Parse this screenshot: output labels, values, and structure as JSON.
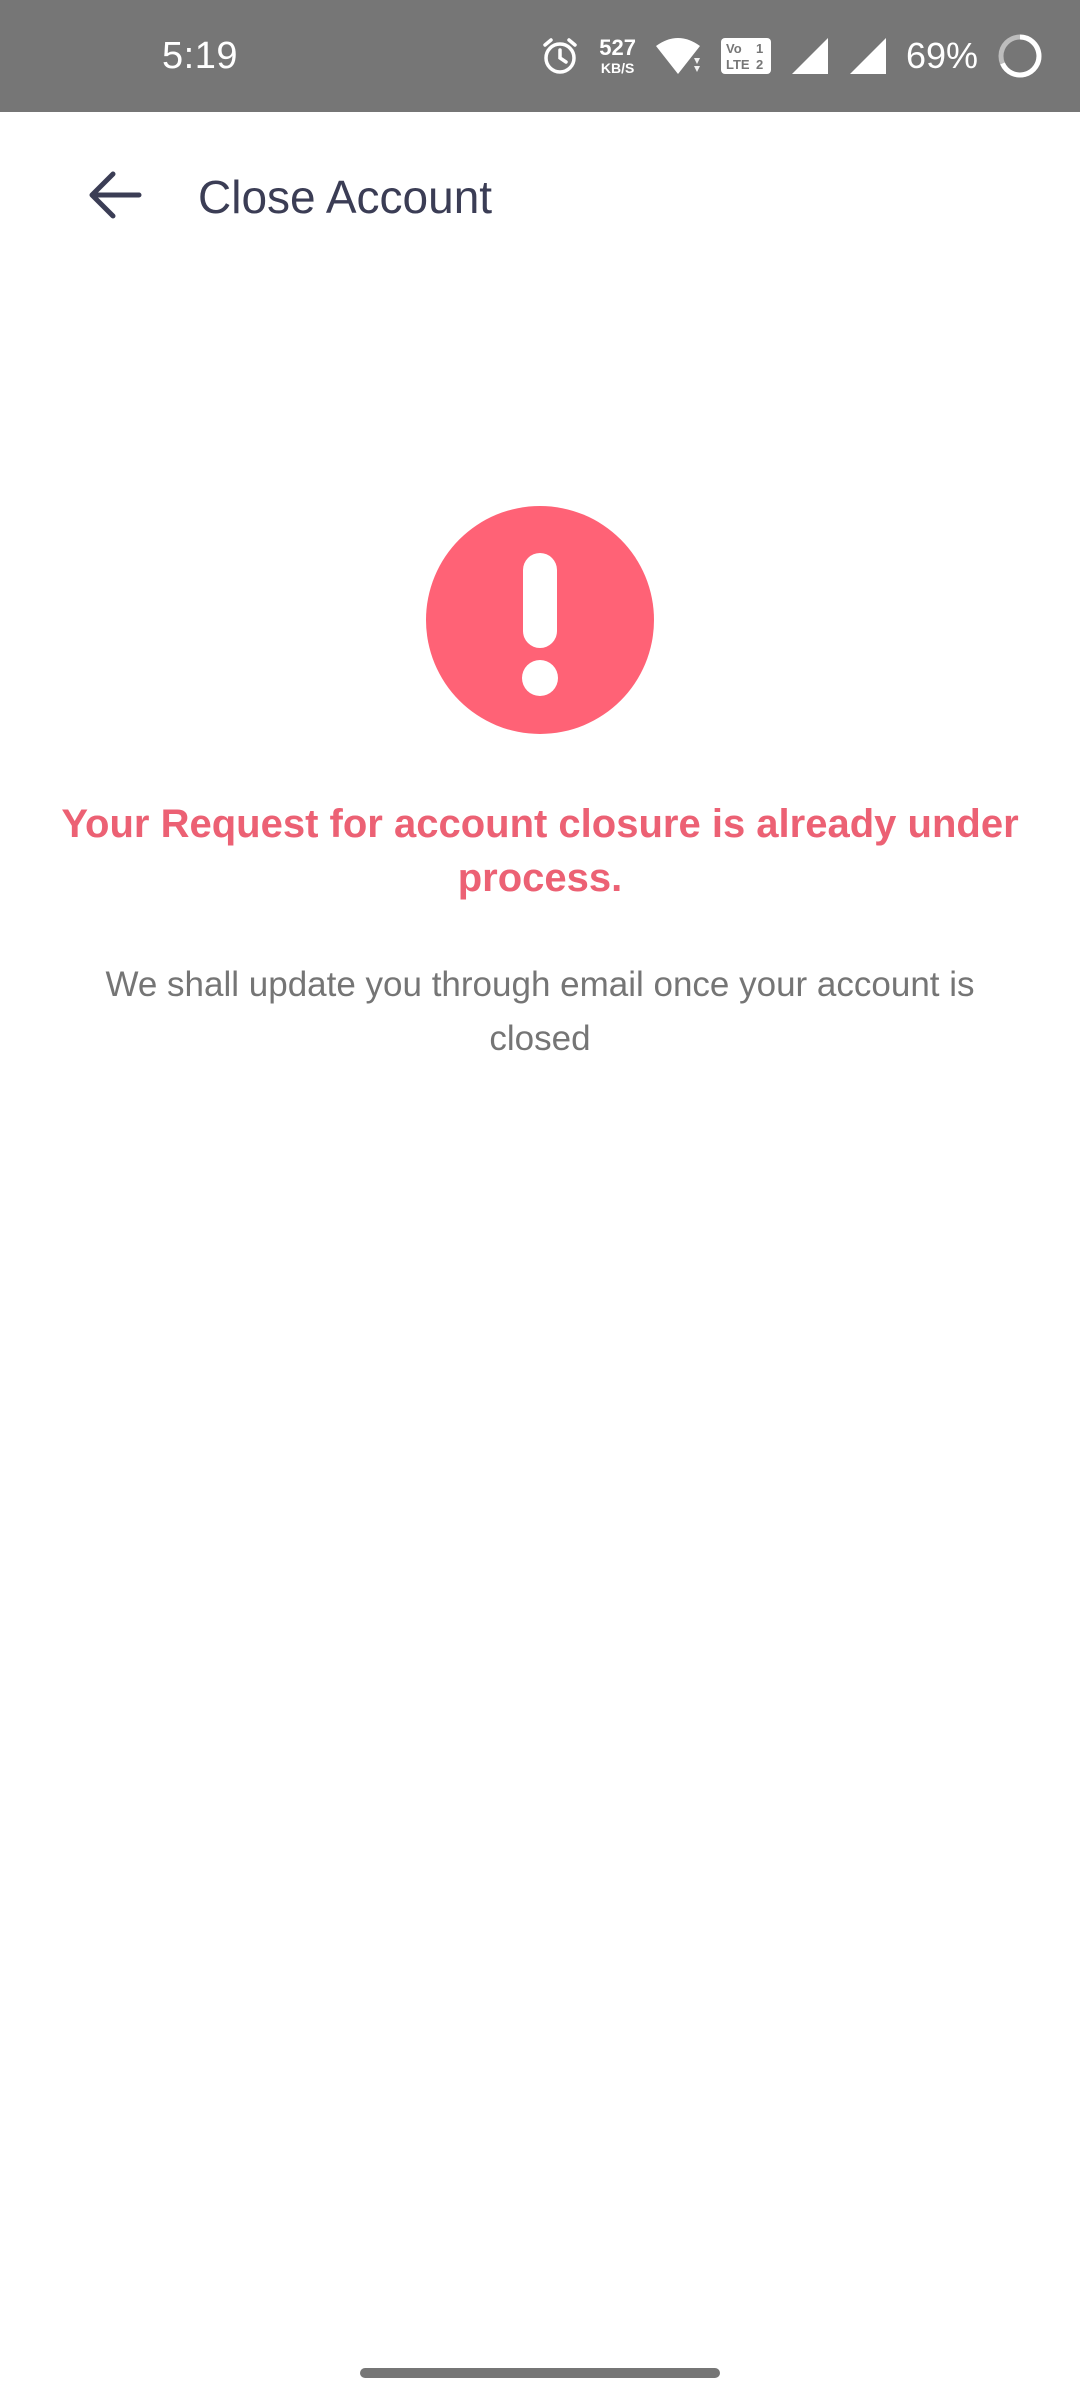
{
  "status_bar": {
    "time": "5:19",
    "speed_value": "527",
    "speed_unit": "KB/S",
    "battery": "69%",
    "icons": [
      "alarm-icon",
      "wifi-icon",
      "volte-icon",
      "signal-icon",
      "signal-icon",
      "battery-icon"
    ]
  },
  "header": {
    "back_icon": "arrow-left-icon",
    "title": "Close Account"
  },
  "main": {
    "alert_icon": "exclamation-circle-icon",
    "headline": "Your Request for account closure is already under process.",
    "message": "We shall update you through email once your account is closed"
  },
  "colors": {
    "status_bar_bg": "#767676",
    "accent": "#ff6276",
    "headline": "#ec6174",
    "title": "#3b3d55",
    "body_text": "#757575"
  }
}
